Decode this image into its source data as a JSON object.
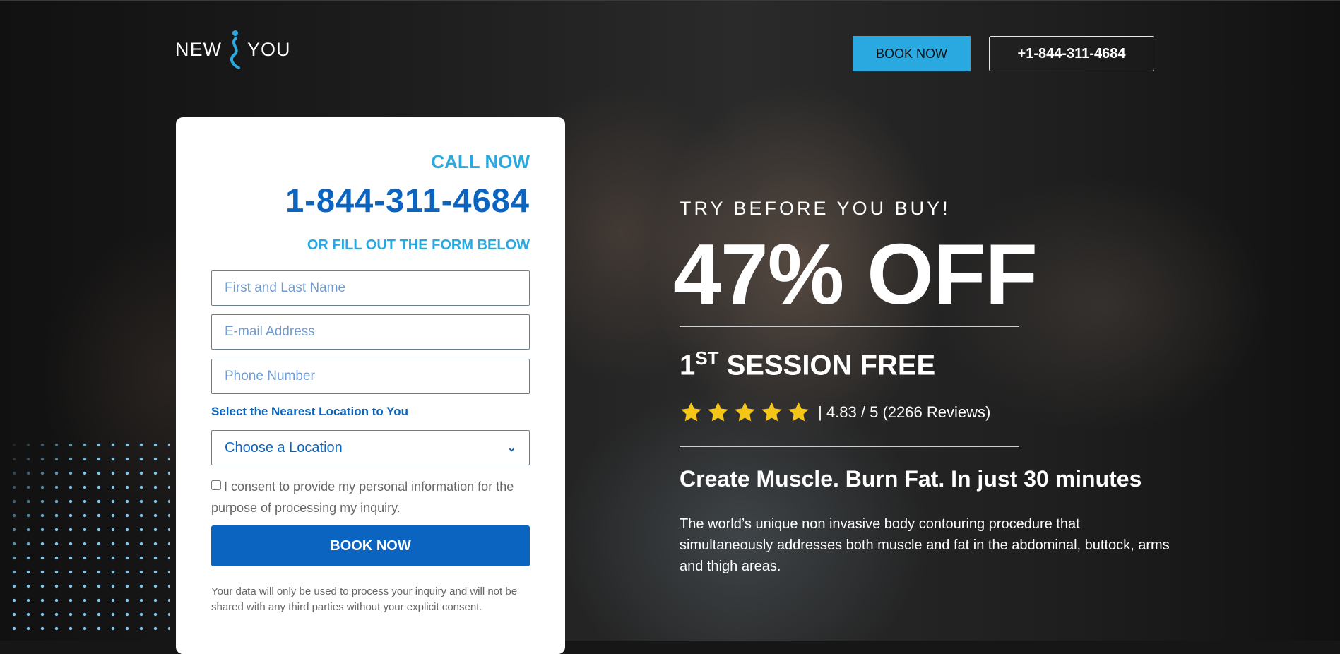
{
  "brand": {
    "logo_left": "NEW",
    "logo_right": "YOU",
    "accent": "#2aa9e0",
    "primary": "#0b64c0"
  },
  "header": {
    "book_now_label": "BOOK NOW",
    "phone_label": "+1-844-311-4684"
  },
  "form": {
    "call_now": "CALL NOW",
    "phone": "1-844-311-4684",
    "or_fill": "OR FILL OUT THE FORM BELOW",
    "name_placeholder": "First and Last Name",
    "email_placeholder": "E-mail Address",
    "phone_placeholder": "Phone Number",
    "location_label": "Select the Nearest Location to You",
    "location_value": "Choose a Location",
    "consent": "I consent to provide my personal information for the purpose of processing my inquiry.",
    "submit_label": "BOOK NOW",
    "privacy": "Your data will only be used to process your inquiry and will not be shared with any third parties without your explicit consent."
  },
  "hero": {
    "try_before": "TRY BEFORE YOU BUY!",
    "discount": "47% OFF",
    "session_num": "1",
    "session_sup": "ST",
    "session_text": " SESSION FREE",
    "rating_text": " | 4.83 / 5 (2266 Reviews)",
    "stars": 5,
    "tagline": "Create Muscle. Burn Fat. In just 30 minutes",
    "description": "The world’s unique non invasive body contouring procedure that simultaneously addresses both muscle and fat in the abdominal, buttock, arms and thigh areas."
  }
}
